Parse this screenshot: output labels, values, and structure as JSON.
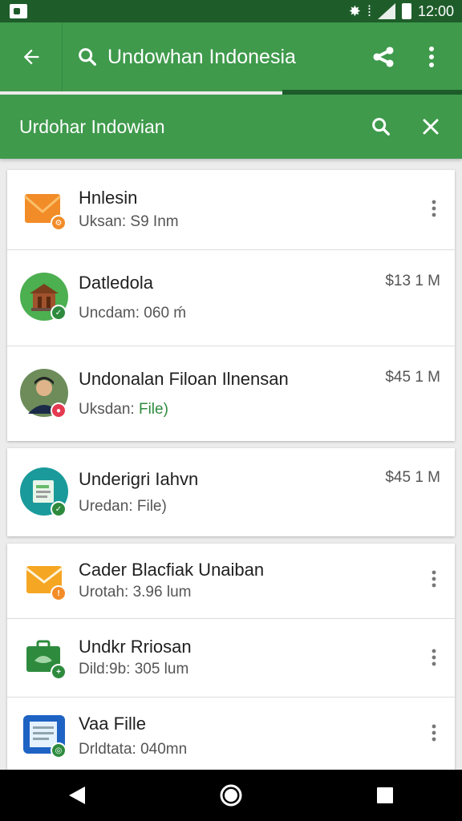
{
  "status_bar": {
    "time": "12:00",
    "icons": [
      "notification-icon",
      "wifi-icon",
      "signal-icon",
      "battery-icon"
    ]
  },
  "app_bar": {
    "search_text": "Undowhan Indonesia",
    "icons": [
      "back-arrow-icon",
      "search-icon",
      "share-icon",
      "more-vert-icon"
    ]
  },
  "sub_bar": {
    "title": "Urdohar Indowian",
    "icons": [
      "search-icon",
      "close-icon"
    ]
  },
  "list": {
    "items": [
      {
        "title": "Hnlesin",
        "subtitle": "Uksan: S9 Inm",
        "icon": "email-icon",
        "action": "more-vert-icon"
      },
      {
        "title": "Datledola",
        "subtitle": "Uncdam: 060 ḿ",
        "price": "$13 1 M",
        "icon": "building-icon"
      },
      {
        "title": "Undonalan Filoan Ilnensan",
        "subtitle_prefix": "Uksdan: ",
        "subtitle_accent": "File)",
        "price": "$45 1 M",
        "icon": "person-avatar"
      },
      {
        "title": "Underigri Iahvn",
        "subtitle": "Uredan: File)",
        "price": "$45 1 M",
        "icon": "document-icon"
      },
      {
        "title": "Cader Blacfiak Unaiban",
        "subtitle": "Urotah: 3.96 lum",
        "icon": "email-icon",
        "action": "more-vert-icon"
      },
      {
        "title": "Undkr Rriosan",
        "subtitle": "Dild:9b: 305 lum",
        "icon": "briefcase-icon",
        "action": "more-vert-icon"
      },
      {
        "title": "Vaa Fille",
        "subtitle": "Drldtata: 040mn",
        "icon": "file-icon",
        "action": "more-vert-icon"
      }
    ]
  },
  "nav_bar": {
    "icons": [
      "back-triangle-icon",
      "home-circle-icon",
      "recents-square-icon"
    ]
  },
  "colors": {
    "primary": "#3f9a4c",
    "primary_dark": "#1e5d2a",
    "accent_green": "#2e8b3e",
    "orange": "#f28c28"
  }
}
